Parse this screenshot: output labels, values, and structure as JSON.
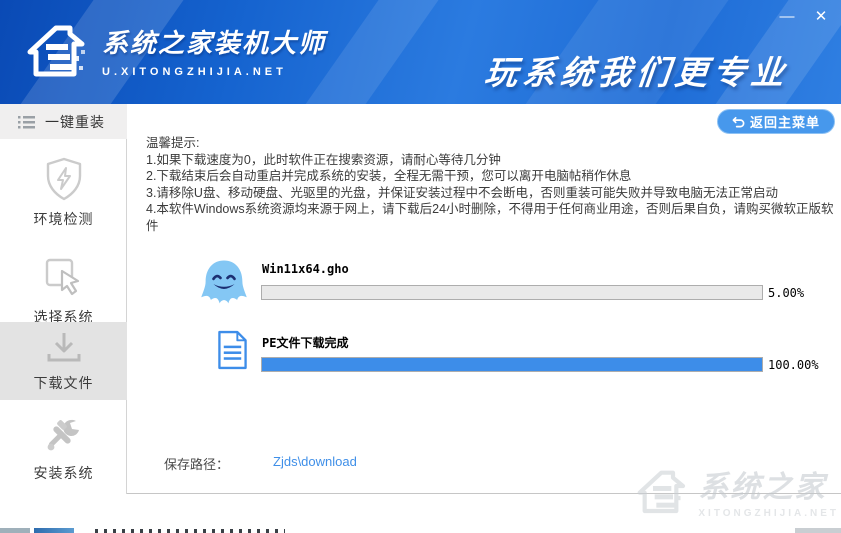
{
  "window": {
    "minimize": "—",
    "close": "✕"
  },
  "header": {
    "brand_title": "系统之家装机大师",
    "brand_url": "U.XITONGZHIJIA.NET",
    "slogan": "玩系统我们更专业"
  },
  "sidebar": {
    "items": [
      {
        "label": "一键重装",
        "icon": "menu-list-icon",
        "active": false
      },
      {
        "label": "环境检测",
        "icon": "shield-bolt-icon",
        "active": false
      },
      {
        "label": "选择系统",
        "icon": "cursor-select-icon",
        "active": false
      },
      {
        "label": "下载文件",
        "icon": "download-icon",
        "active": true
      },
      {
        "label": "安装系统",
        "icon": "tools-icon",
        "active": false
      }
    ]
  },
  "main": {
    "return_button": "返回主菜单",
    "tips": {
      "title": "温馨提示:",
      "lines": [
        "1.如果下载速度为0，此时软件正在搜索资源，请耐心等待几分钟",
        "2.下载结束后会自动重启并完成系统的安装，全程无需干预，您可以离开电脑帖稍作休息",
        "3.请移除U盘、移动硬盘、光驱里的光盘，并保证安装过程中不会断电，否则重装可能失败并导致电脑无法正常启动",
        "4.本软件Windows系统资源均来源于网上，请下载后24小时删除，不得用于任何商业用途，否则后果自负，请购买微软正版软件"
      ]
    },
    "downloads": [
      {
        "icon": "ghost-icon",
        "label": "Win11x64.gho",
        "percent_text": "5.00%",
        "bar_fill_percent": 0
      },
      {
        "icon": "document-icon",
        "label": "PE文件下载完成",
        "percent_text": "100.00%",
        "bar_fill_percent": 100
      }
    ],
    "save_path": {
      "label": "保存路径：",
      "value": "Zjds\\download"
    }
  },
  "watermark": {
    "title": "系统之家",
    "subtitle": "XITONGZHIJIA.NET"
  },
  "colors": {
    "header_blue": "#1e6cd6",
    "progress_fill": "#3d8de9",
    "button_blue": "#4798ec",
    "link_blue": "#3f8fe8",
    "active_item_bg": "#e3e3e3"
  }
}
